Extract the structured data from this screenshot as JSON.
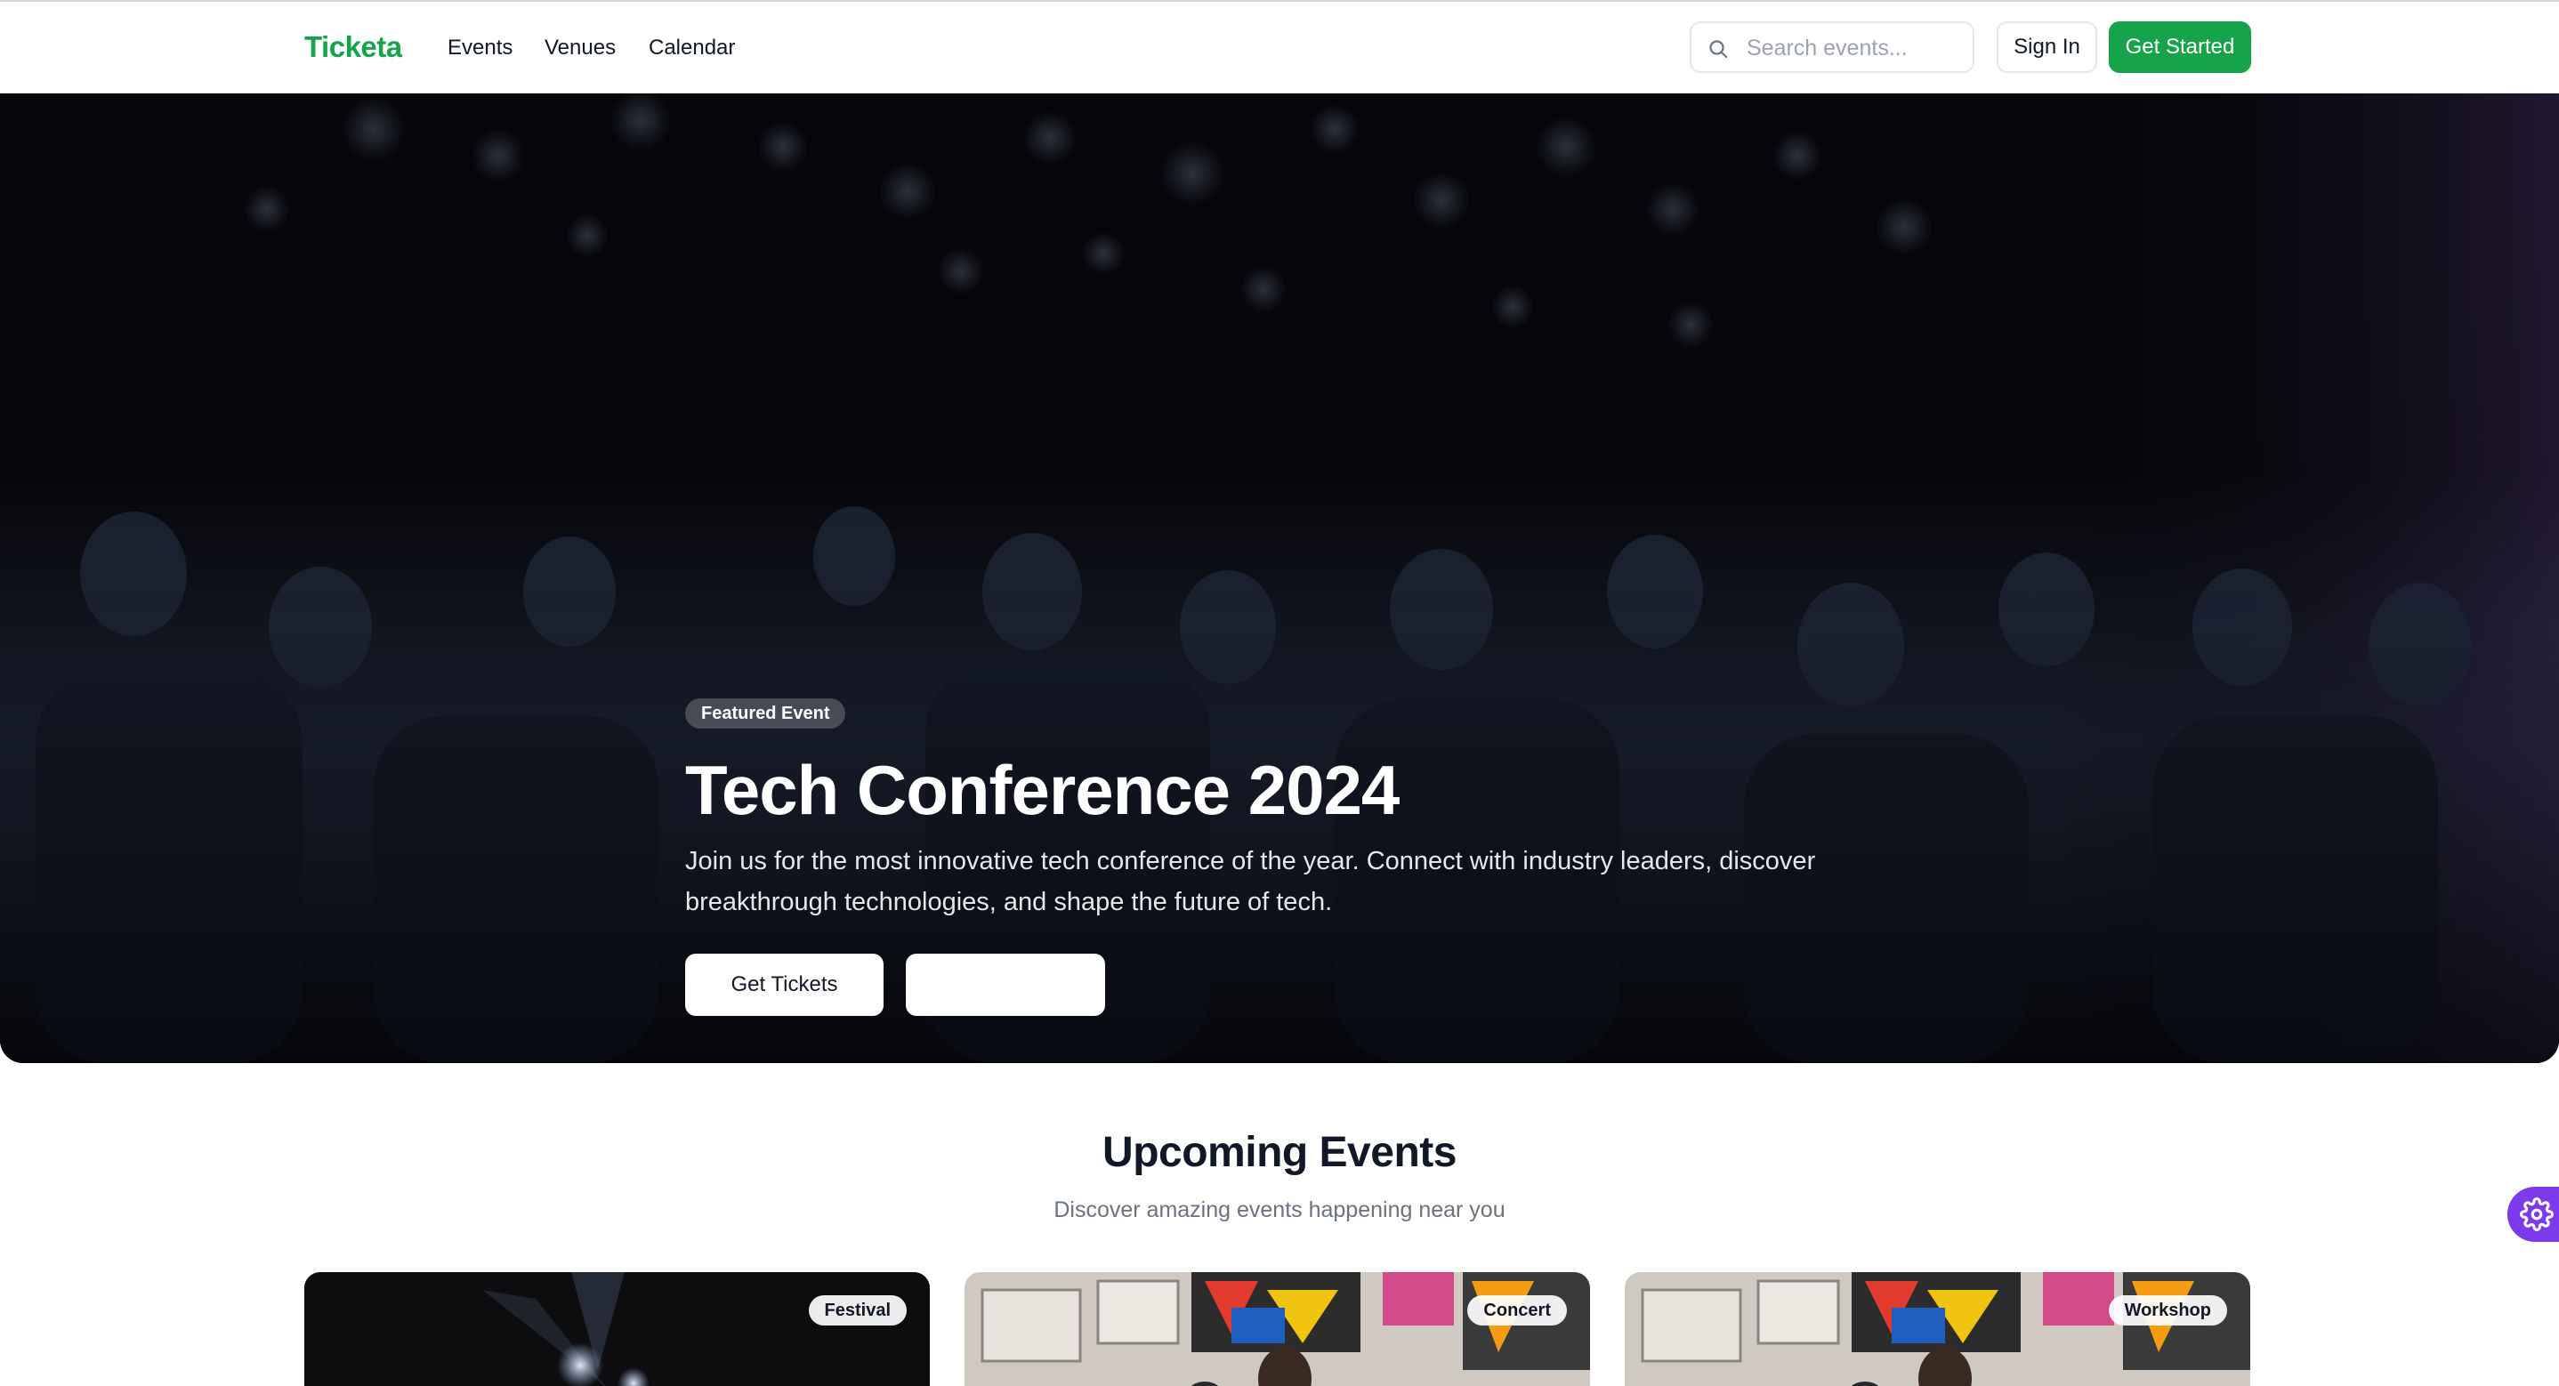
{
  "nav": {
    "logo": "Ticketa",
    "links": [
      "Events",
      "Venues",
      "Calendar"
    ],
    "search_placeholder": "Search events...",
    "sign_in": "Sign In",
    "get_started": "Get Started"
  },
  "hero": {
    "badge": "Featured Event",
    "title": "Tech Conference 2024",
    "description": "Join us for the most innovative tech conference of the year. Connect with industry leaders, discover breakthrough technologies, and shape the future of tech.",
    "primary_button": "Get Tickets",
    "secondary_button": ""
  },
  "section": {
    "title": "Upcoming Events",
    "subtitle": "Discover amazing events happening near you"
  },
  "cards": [
    {
      "category": "Festival"
    },
    {
      "category": "Concert"
    },
    {
      "category": "Workshop"
    }
  ],
  "colors": {
    "brand": "#16a34a",
    "fab": "#7c3aed"
  }
}
